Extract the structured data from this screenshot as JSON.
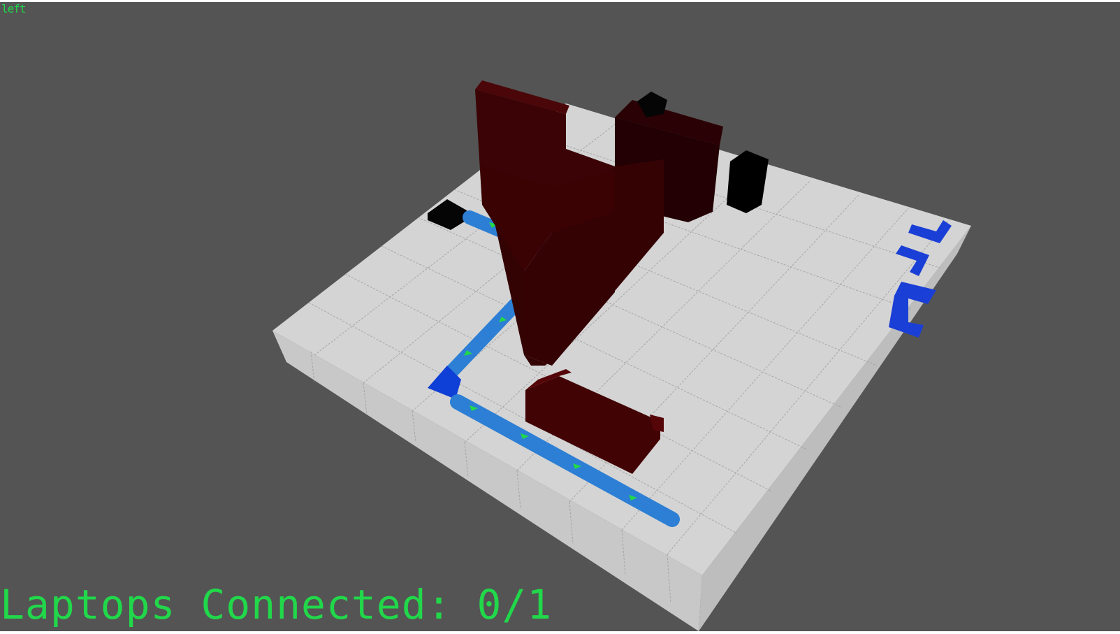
{
  "hud": {
    "view_name": "left",
    "status": "Laptops Connected: 0/1"
  },
  "colors": {
    "background": "#545454",
    "floor_top": "#d3d3d3",
    "floor_side": "#c4c4c4",
    "grid_lines": "#9a9a9a",
    "wall": "#3a0203",
    "wall_dark": "#220002",
    "laptop": "#000000",
    "cable": "#2b7fd6",
    "cable_joint": "#0e3fd6",
    "signal": "#21d84a",
    "hud_text": "#21d84a"
  },
  "icons": {
    "laptop": "black-box",
    "cable_piece": "blue-tube",
    "signal_packet": "green-arrow"
  }
}
